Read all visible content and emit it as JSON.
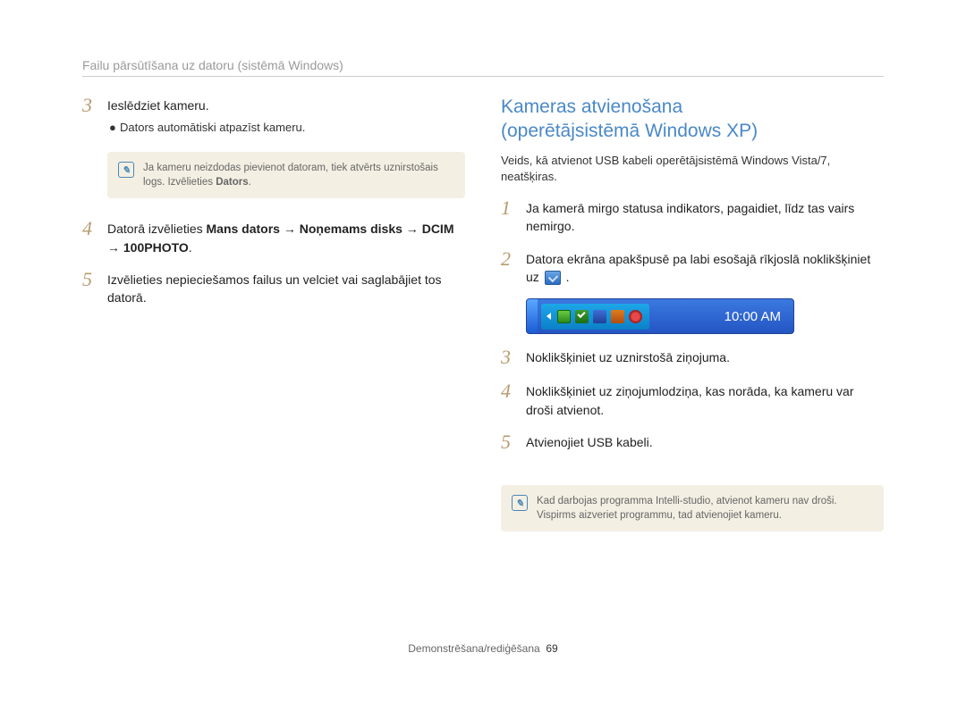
{
  "header": "Failu pārsūtīšana uz datoru (sistēmā Windows)",
  "left": {
    "step3": {
      "num": "3",
      "text": "Ieslēdziet kameru.",
      "bullet": "Dators automātiski atpazīst kameru."
    },
    "note1": {
      "text_a": "Ja kameru neizdodas pievienot datoram, tiek atvērts uznirstošais logs. Izvēlieties ",
      "text_bold": "Dators",
      "text_b": "."
    },
    "step4": {
      "num": "4",
      "pre": "Datorā izvēlieties ",
      "b1": "Mans dators",
      "ar1": " → ",
      "b2": "Noņemams disks",
      "ar2": " → ",
      "b3": "DCIM",
      "ar3": " → ",
      "b4": "100PHOTO",
      "end": "."
    },
    "step5": {
      "num": "5",
      "text": "Izvēlieties nepieciešamos failus un velciet vai saglabājiet tos datorā."
    }
  },
  "right": {
    "title_a": "Kameras atvienošana",
    "title_b": "(operētājsistēmā Windows XP)",
    "intro": "Veids, kā atvienot USB kabeli operētājsistēmā Windows Vista/7, neatšķiras.",
    "step1": {
      "num": "1",
      "text": "Ja kamerā mirgo statusa indikators, pagaidiet, līdz tas vairs nemirgo."
    },
    "step2": {
      "num": "2",
      "text_a": "Datora ekrāna apakšpusē pa labi esošajā rīkjoslā noklikšķiniet uz ",
      "text_b": " ."
    },
    "taskbar_time": "10:00 AM",
    "step3": {
      "num": "3",
      "text": "Noklikšķiniet uz uznirstošā ziņojuma."
    },
    "step4": {
      "num": "4",
      "text": "Noklikšķiniet uz ziņojumlodziņa, kas norāda, ka kameru var droši atvienot."
    },
    "step5": {
      "num": "5",
      "text": "Atvienojiet USB kabeli."
    },
    "note2": "Kad darbojas programma Intelli-studio, atvienot kameru nav droši. Vispirms aizveriet programmu, tad atvienojiet kameru."
  },
  "footer": {
    "label": "Demonstrēšana/rediģēšana",
    "page": "69"
  }
}
